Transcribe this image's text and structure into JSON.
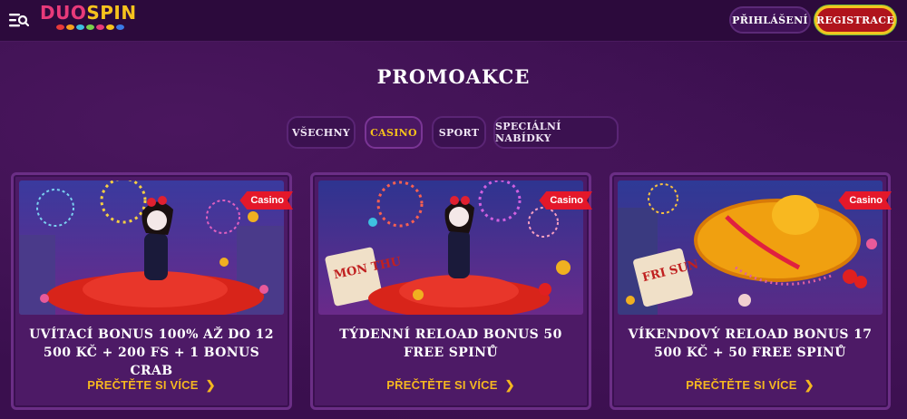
{
  "header": {
    "logo_text": "DUOSPIN",
    "login_label": "PŘIHLÁŠENÍ",
    "register_label": "REGISTRACE"
  },
  "page": {
    "title": "PROMOAKCE"
  },
  "tabs": [
    {
      "label": "VŠECHNY",
      "active": false
    },
    {
      "label": "CASINO",
      "active": true
    },
    {
      "label": "SPORT",
      "active": false
    },
    {
      "label": "SPECIÁLNÍ NABÍDKY",
      "active": false
    }
  ],
  "cards": [
    {
      "badge": "Casino",
      "title": "UVÍTACÍ BONUS 100% AŽ DO 12 500 KČ + 200 FS + 1 BONUS CRAB",
      "link": "PŘEČTĚTE SI VÍCE"
    },
    {
      "badge": "Casino",
      "title": "TÝDENNÍ RELOAD BONUS 50 FREE SPINŮ",
      "link": "PŘEČTĚTE SI VÍCE",
      "sign_text": "MON THU"
    },
    {
      "badge": "Casino",
      "title": "VÍKENDOVÝ RELOAD BONUS 17 500 KČ + 50 FREE SPINŮ",
      "link": "PŘEČTĚTE SI VÍCE",
      "sign_text": "FRI SUN"
    }
  ],
  "colors": {
    "accent": "#f5b720",
    "badge": "#e4182a",
    "register": "#b0141c",
    "background": "#3a0f4e"
  },
  "icons": {
    "menu": "menu-search-icon",
    "chevron": "chevron-right-icon"
  }
}
